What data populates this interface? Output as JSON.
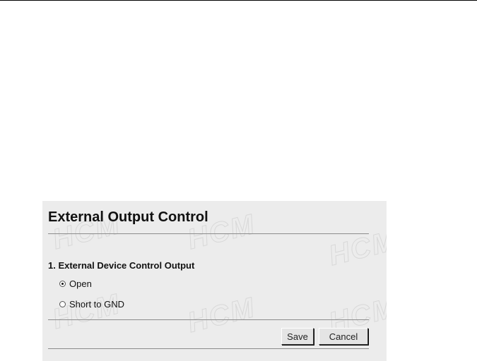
{
  "page": {
    "title": "External Output Control",
    "watermark_text": "HCM",
    "accent_color": "#ececec"
  },
  "section": {
    "heading": "1. External Device Control Output",
    "options": [
      {
        "label": "Open",
        "selected": true
      },
      {
        "label": "Short to GND",
        "selected": false
      }
    ]
  },
  "actions": {
    "save_label": "Save",
    "cancel_label": "Cancel"
  }
}
